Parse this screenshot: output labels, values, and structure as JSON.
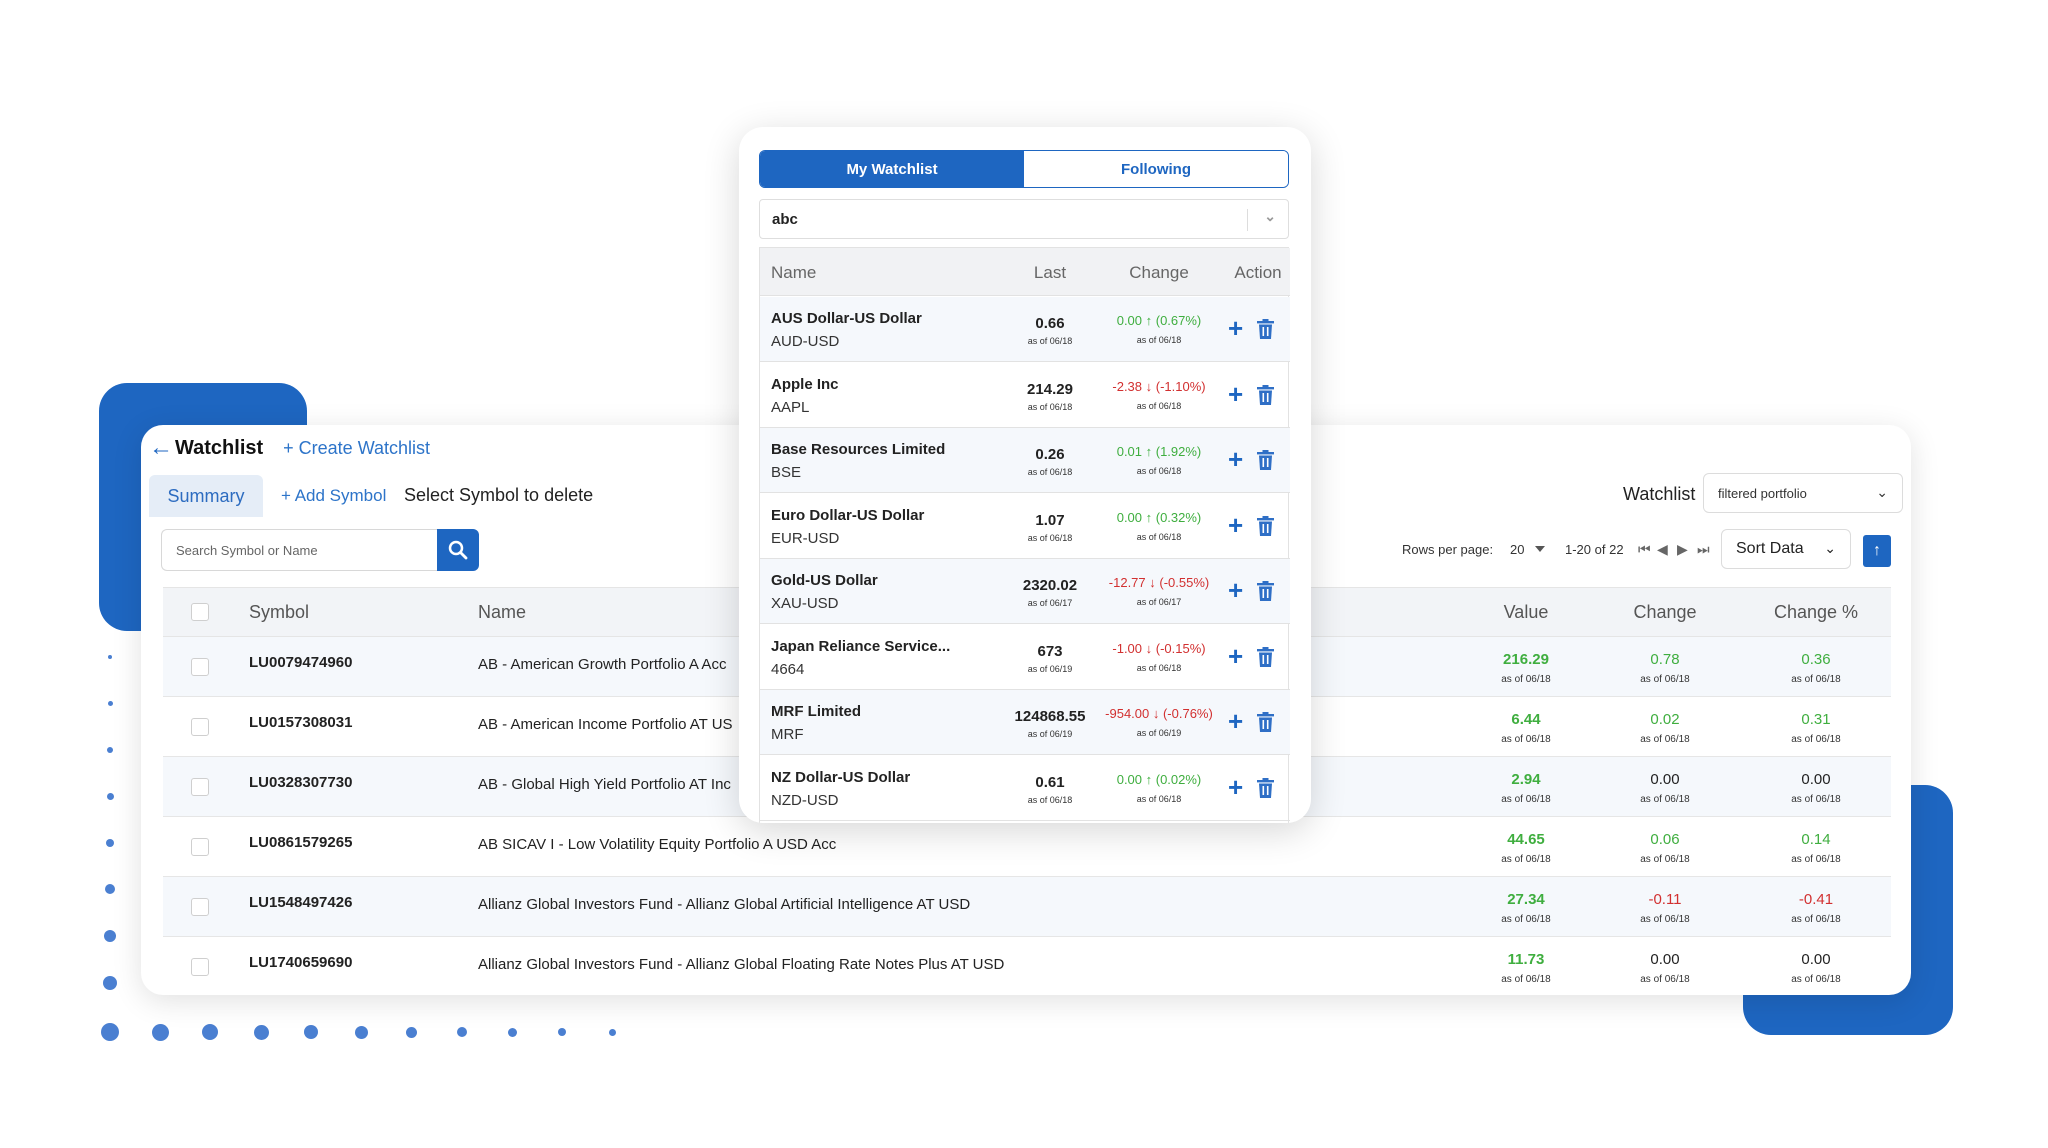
{
  "main": {
    "title": "Watchlist",
    "create_link": "+ Create Watchlist",
    "tab_summary": "Summary",
    "add_symbol": "+ Add Symbol",
    "select_delete": "Select Symbol to delete",
    "watchlist_label": "Watchlist",
    "watchlist_selected": "filtered portfolio",
    "search_placeholder": "Search Symbol or Name",
    "rows_per_page_label": "Rows per page:",
    "rows_per_page_value": "20",
    "range": "1-20 of 22",
    "sort_label": "Sort Data",
    "columns": [
      "Symbol",
      "Name",
      "Value",
      "Change",
      "Change %"
    ],
    "rows": [
      {
        "symbol": "LU0079474960",
        "name": "AB - American Growth Portfolio A Acc",
        "value": "216.29",
        "value_asof": "as of 06/18",
        "change": "0.78",
        "change_asof": "as of 06/18",
        "change_pct": "0.36",
        "change_pct_asof": "as of 06/18",
        "dir": "pos"
      },
      {
        "symbol": "LU0157308031",
        "name": "AB - American Income Portfolio AT US",
        "value": "6.44",
        "value_asof": "as of 06/18",
        "change": "0.02",
        "change_asof": "as of 06/18",
        "change_pct": "0.31",
        "change_pct_asof": "as of 06/18",
        "dir": "pos"
      },
      {
        "symbol": "LU0328307730",
        "name": "AB - Global High Yield Portfolio AT Inc",
        "value": "2.94",
        "value_asof": "as of 06/18",
        "change": "0.00",
        "change_asof": "as of 06/18",
        "change_pct": "0.00",
        "change_pct_asof": "as of 06/18",
        "dir": "neu"
      },
      {
        "symbol": "LU0861579265",
        "name": "AB SICAV I - Low Volatility Equity Portfolio A USD Acc",
        "value": "44.65",
        "value_asof": "as of 06/18",
        "change": "0.06",
        "change_asof": "as of 06/18",
        "change_pct": "0.14",
        "change_pct_asof": "as of 06/18",
        "dir": "pos"
      },
      {
        "symbol": "LU1548497426",
        "name": "Allianz Global Investors Fund - Allianz Global Artificial Intelligence AT USD",
        "value": "27.34",
        "value_asof": "as of 06/18",
        "change": "-0.11",
        "change_asof": "as of 06/18",
        "change_pct": "-0.41",
        "change_pct_asof": "as of 06/18",
        "dir": "neg"
      },
      {
        "symbol": "LU1740659690",
        "name": "Allianz Global Investors Fund - Allianz Global Floating Rate Notes Plus AT USD",
        "value": "11.73",
        "value_asof": "as of 06/18",
        "change": "0.00",
        "change_asof": "as of 06/18",
        "change_pct": "0.00",
        "change_pct_asof": "as of 06/18",
        "dir": "neu"
      }
    ]
  },
  "popup": {
    "tab_active": "My Watchlist",
    "tab_inactive": "Following",
    "selected_list": "abc",
    "columns": [
      "Name",
      "Last",
      "Change",
      "Action"
    ],
    "rows": [
      {
        "name": "AUS Dollar-US Dollar",
        "symbol": "AUD-USD",
        "last": "0.66",
        "last_asof": "as of 06/18",
        "change": "0.00 ↑ (0.67%)",
        "change_asof": "as of 06/18",
        "dir": "pos"
      },
      {
        "name": "Apple Inc",
        "symbol": "AAPL",
        "last": "214.29",
        "last_asof": "as of 06/18",
        "change": "-2.38 ↓ (-1.10%)",
        "change_asof": "as of 06/18",
        "dir": "neg"
      },
      {
        "name": "Base Resources Limited",
        "symbol": "BSE",
        "last": "0.26",
        "last_asof": "as of 06/18",
        "change": "0.01 ↑ (1.92%)",
        "change_asof": "as of 06/18",
        "dir": "pos"
      },
      {
        "name": "Euro Dollar-US Dollar",
        "symbol": "EUR-USD",
        "last": "1.07",
        "last_asof": "as of 06/18",
        "change": "0.00 ↑ (0.32%)",
        "change_asof": "as of 06/18",
        "dir": "pos"
      },
      {
        "name": "Gold-US Dollar",
        "symbol": "XAU-USD",
        "last": "2320.02",
        "last_asof": "as of 06/17",
        "change": "-12.77 ↓ (-0.55%)",
        "change_asof": "as of 06/17",
        "dir": "neg"
      },
      {
        "name": "Japan Reliance Service...",
        "symbol": "4664",
        "last": "673",
        "last_asof": "as of 06/19",
        "change": "-1.00 ↓ (-0.15%)",
        "change_asof": "as of 06/18",
        "dir": "neg"
      },
      {
        "name": "MRF Limited",
        "symbol": "MRF",
        "last": "124868.55",
        "last_asof": "as of 06/19",
        "change": "-954.00 ↓ (-0.76%)",
        "change_asof": "as of 06/19",
        "dir": "neg"
      },
      {
        "name": "NZ Dollar-US Dollar",
        "symbol": "NZD-USD",
        "last": "0.61",
        "last_asof": "as of 06/18",
        "change": "0.00 ↑ (0.02%)",
        "change_asof": "as of 06/18",
        "dir": "pos"
      }
    ]
  },
  "colors": {
    "accent": "#1e66c1",
    "positive": "#3fae3f",
    "negative": "#d23030"
  },
  "icons": [
    "back-arrow-icon",
    "search-icon",
    "chevron-down-icon",
    "first-page-icon",
    "prev-page-icon",
    "next-page-icon",
    "last-page-icon",
    "sort-direction-icon",
    "add-icon",
    "trash-icon"
  ]
}
